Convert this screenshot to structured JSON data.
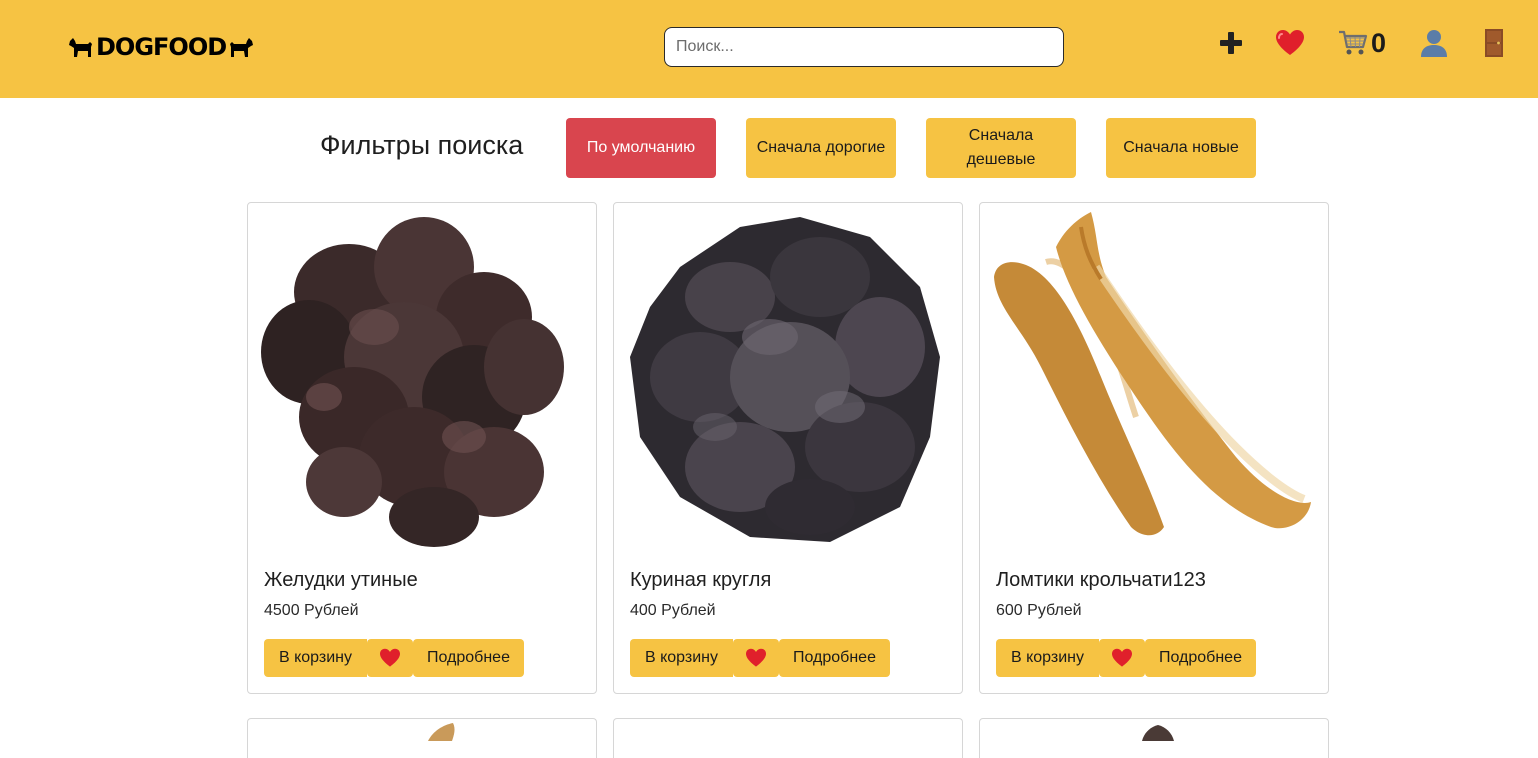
{
  "header": {
    "logo_text": "DOGFOOD",
    "search_placeholder": "Поиск...",
    "icons": [
      "plus-icon",
      "heart-icon",
      "cart-icon",
      "user-icon",
      "door-icon"
    ],
    "cart_count": "0",
    "background": "#f6c343"
  },
  "filters": {
    "title": "Фильтры поиска",
    "options": [
      {
        "label": "По умолчанию",
        "active": true
      },
      {
        "label": "Сначала дорогие",
        "active": false
      },
      {
        "label": "Сначала дешевые",
        "active": false
      },
      {
        "label": "Сначала новые",
        "active": false
      }
    ],
    "active_color": "#d9454e",
    "accent_color": "#f6c343"
  },
  "products": [
    {
      "title": "Желудки утиные",
      "price": "4500 Рублей",
      "image": "duck-stomachs-photo"
    },
    {
      "title": "Куриная кругля",
      "price": "400 Рублей",
      "image": "chicken-round-photo"
    },
    {
      "title": "Ломтики крольчати123",
      "price": "600 Рублей",
      "image": "rabbit-slices-photo"
    }
  ],
  "card_buttons": {
    "add_to_cart": "В корзину",
    "favorite_icon": "heart-icon",
    "details": "Подробнее"
  }
}
